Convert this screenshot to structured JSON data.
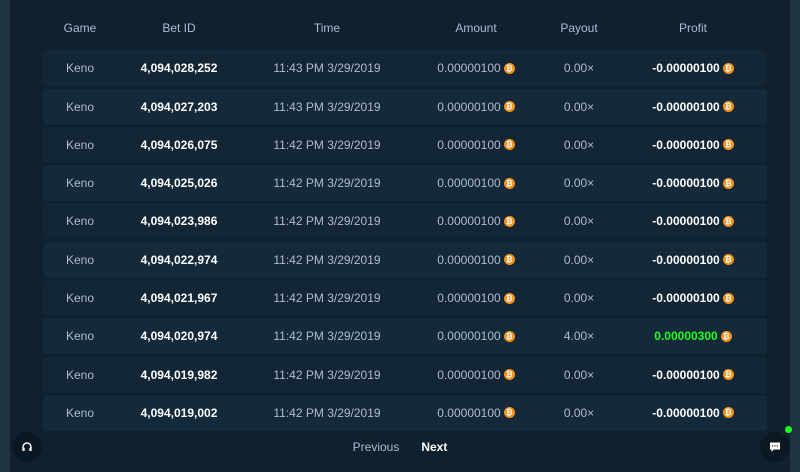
{
  "colors": {
    "page_bg": "#182a38",
    "panel_bg": "#0f212e",
    "row_bg": "#132635",
    "text_muted": "#b1bad3",
    "text_strong": "#ffffff",
    "win_green": "#1fff20",
    "coin_orange": "#f7931a"
  },
  "table": {
    "headers": {
      "game": "Game",
      "bet_id": "Bet ID",
      "time": "Time",
      "amount": "Amount",
      "payout": "Payout",
      "profit": "Profit"
    },
    "currency_icon": "bitcoin-icon",
    "rows": [
      {
        "game": "Keno",
        "bet_id": "4,094,028,252",
        "time": "11:43 PM 3/29/2019",
        "amount": "0.00000100",
        "payout": "0.00×",
        "profit": "-0.00000100",
        "win": false
      },
      {
        "game": "Keno",
        "bet_id": "4,094,027,203",
        "time": "11:43 PM 3/29/2019",
        "amount": "0.00000100",
        "payout": "0.00×",
        "profit": "-0.00000100",
        "win": false
      },
      {
        "game": "Keno",
        "bet_id": "4,094,026,075",
        "time": "11:42 PM 3/29/2019",
        "amount": "0.00000100",
        "payout": "0.00×",
        "profit": "-0.00000100",
        "win": false
      },
      {
        "game": "Keno",
        "bet_id": "4,094,025,026",
        "time": "11:42 PM 3/29/2019",
        "amount": "0.00000100",
        "payout": "0.00×",
        "profit": "-0.00000100",
        "win": false
      },
      {
        "game": "Keno",
        "bet_id": "4,094,023,986",
        "time": "11:42 PM 3/29/2019",
        "amount": "0.00000100",
        "payout": "0.00×",
        "profit": "-0.00000100",
        "win": false
      },
      {
        "game": "Keno",
        "bet_id": "4,094,022,974",
        "time": "11:42 PM 3/29/2019",
        "amount": "0.00000100",
        "payout": "0.00×",
        "profit": "-0.00000100",
        "win": false
      },
      {
        "game": "Keno",
        "bet_id": "4,094,021,967",
        "time": "11:42 PM 3/29/2019",
        "amount": "0.00000100",
        "payout": "0.00×",
        "profit": "-0.00000100",
        "win": false
      },
      {
        "game": "Keno",
        "bet_id": "4,094,020,974",
        "time": "11:42 PM 3/29/2019",
        "amount": "0.00000100",
        "payout": "4.00×",
        "profit": "0.00000300",
        "win": true
      },
      {
        "game": "Keno",
        "bet_id": "4,094,019,982",
        "time": "11:42 PM 3/29/2019",
        "amount": "0.00000100",
        "payout": "0.00×",
        "profit": "-0.00000100",
        "win": false
      },
      {
        "game": "Keno",
        "bet_id": "4,094,019,002",
        "time": "11:42 PM 3/29/2019",
        "amount": "0.00000100",
        "payout": "0.00×",
        "profit": "-0.00000100",
        "win": false
      }
    ]
  },
  "pagination": {
    "previous_label": "Previous",
    "next_label": "Next"
  },
  "floating": {
    "support_icon": "headset-icon",
    "chat_icon": "chat-icon",
    "online_indicator": true
  }
}
